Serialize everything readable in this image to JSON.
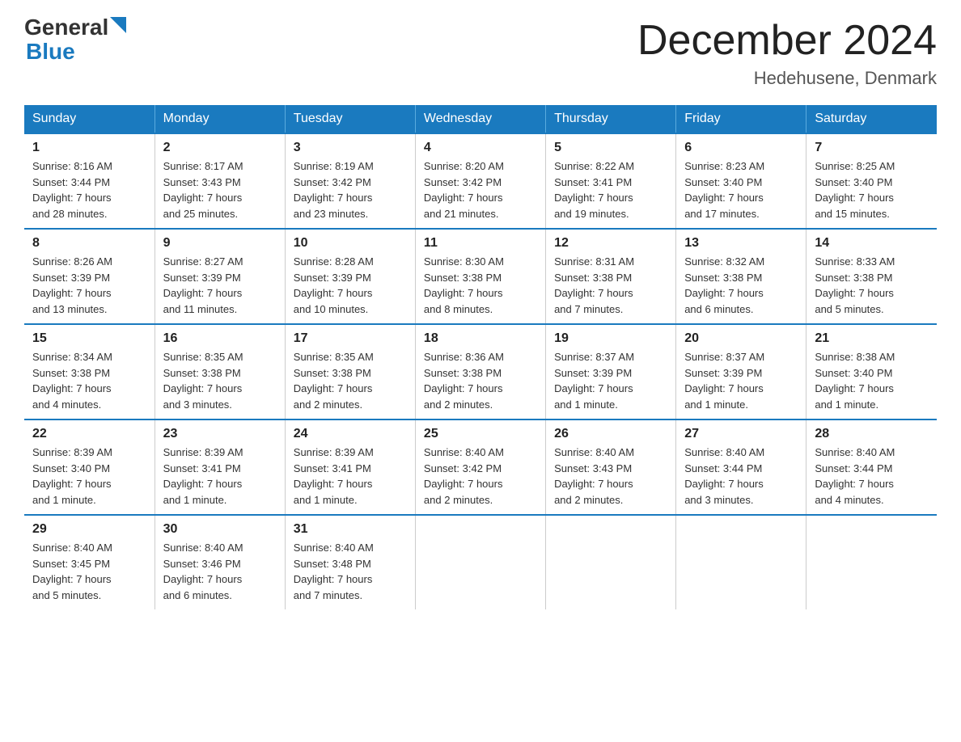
{
  "logo": {
    "text_general": "General",
    "text_blue": "Blue",
    "triangle": "▶"
  },
  "header": {
    "month": "December 2024",
    "location": "Hedehusene, Denmark"
  },
  "weekdays": [
    "Sunday",
    "Monday",
    "Tuesday",
    "Wednesday",
    "Thursday",
    "Friday",
    "Saturday"
  ],
  "weeks": [
    [
      {
        "day": "1",
        "sunrise": "8:16 AM",
        "sunset": "3:44 PM",
        "daylight": "7 hours and 28 minutes."
      },
      {
        "day": "2",
        "sunrise": "8:17 AM",
        "sunset": "3:43 PM",
        "daylight": "7 hours and 25 minutes."
      },
      {
        "day": "3",
        "sunrise": "8:19 AM",
        "sunset": "3:42 PM",
        "daylight": "7 hours and 23 minutes."
      },
      {
        "day": "4",
        "sunrise": "8:20 AM",
        "sunset": "3:42 PM",
        "daylight": "7 hours and 21 minutes."
      },
      {
        "day": "5",
        "sunrise": "8:22 AM",
        "sunset": "3:41 PM",
        "daylight": "7 hours and 19 minutes."
      },
      {
        "day": "6",
        "sunrise": "8:23 AM",
        "sunset": "3:40 PM",
        "daylight": "7 hours and 17 minutes."
      },
      {
        "day": "7",
        "sunrise": "8:25 AM",
        "sunset": "3:40 PM",
        "daylight": "7 hours and 15 minutes."
      }
    ],
    [
      {
        "day": "8",
        "sunrise": "8:26 AM",
        "sunset": "3:39 PM",
        "daylight": "7 hours and 13 minutes."
      },
      {
        "day": "9",
        "sunrise": "8:27 AM",
        "sunset": "3:39 PM",
        "daylight": "7 hours and 11 minutes."
      },
      {
        "day": "10",
        "sunrise": "8:28 AM",
        "sunset": "3:39 PM",
        "daylight": "7 hours and 10 minutes."
      },
      {
        "day": "11",
        "sunrise": "8:30 AM",
        "sunset": "3:38 PM",
        "daylight": "7 hours and 8 minutes."
      },
      {
        "day": "12",
        "sunrise": "8:31 AM",
        "sunset": "3:38 PM",
        "daylight": "7 hours and 7 minutes."
      },
      {
        "day": "13",
        "sunrise": "8:32 AM",
        "sunset": "3:38 PM",
        "daylight": "7 hours and 6 minutes."
      },
      {
        "day": "14",
        "sunrise": "8:33 AM",
        "sunset": "3:38 PM",
        "daylight": "7 hours and 5 minutes."
      }
    ],
    [
      {
        "day": "15",
        "sunrise": "8:34 AM",
        "sunset": "3:38 PM",
        "daylight": "7 hours and 4 minutes."
      },
      {
        "day": "16",
        "sunrise": "8:35 AM",
        "sunset": "3:38 PM",
        "daylight": "7 hours and 3 minutes."
      },
      {
        "day": "17",
        "sunrise": "8:35 AM",
        "sunset": "3:38 PM",
        "daylight": "7 hours and 2 minutes."
      },
      {
        "day": "18",
        "sunrise": "8:36 AM",
        "sunset": "3:38 PM",
        "daylight": "7 hours and 2 minutes."
      },
      {
        "day": "19",
        "sunrise": "8:37 AM",
        "sunset": "3:39 PM",
        "daylight": "7 hours and 1 minute."
      },
      {
        "day": "20",
        "sunrise": "8:37 AM",
        "sunset": "3:39 PM",
        "daylight": "7 hours and 1 minute."
      },
      {
        "day": "21",
        "sunrise": "8:38 AM",
        "sunset": "3:40 PM",
        "daylight": "7 hours and 1 minute."
      }
    ],
    [
      {
        "day": "22",
        "sunrise": "8:39 AM",
        "sunset": "3:40 PM",
        "daylight": "7 hours and 1 minute."
      },
      {
        "day": "23",
        "sunrise": "8:39 AM",
        "sunset": "3:41 PM",
        "daylight": "7 hours and 1 minute."
      },
      {
        "day": "24",
        "sunrise": "8:39 AM",
        "sunset": "3:41 PM",
        "daylight": "7 hours and 1 minute."
      },
      {
        "day": "25",
        "sunrise": "8:40 AM",
        "sunset": "3:42 PM",
        "daylight": "7 hours and 2 minutes."
      },
      {
        "day": "26",
        "sunrise": "8:40 AM",
        "sunset": "3:43 PM",
        "daylight": "7 hours and 2 minutes."
      },
      {
        "day": "27",
        "sunrise": "8:40 AM",
        "sunset": "3:44 PM",
        "daylight": "7 hours and 3 minutes."
      },
      {
        "day": "28",
        "sunrise": "8:40 AM",
        "sunset": "3:44 PM",
        "daylight": "7 hours and 4 minutes."
      }
    ],
    [
      {
        "day": "29",
        "sunrise": "8:40 AM",
        "sunset": "3:45 PM",
        "daylight": "7 hours and 5 minutes."
      },
      {
        "day": "30",
        "sunrise": "8:40 AM",
        "sunset": "3:46 PM",
        "daylight": "7 hours and 6 minutes."
      },
      {
        "day": "31",
        "sunrise": "8:40 AM",
        "sunset": "3:48 PM",
        "daylight": "7 hours and 7 minutes."
      },
      null,
      null,
      null,
      null
    ]
  ],
  "labels": {
    "sunrise": "Sunrise:",
    "sunset": "Sunset:",
    "daylight": "Daylight:"
  }
}
